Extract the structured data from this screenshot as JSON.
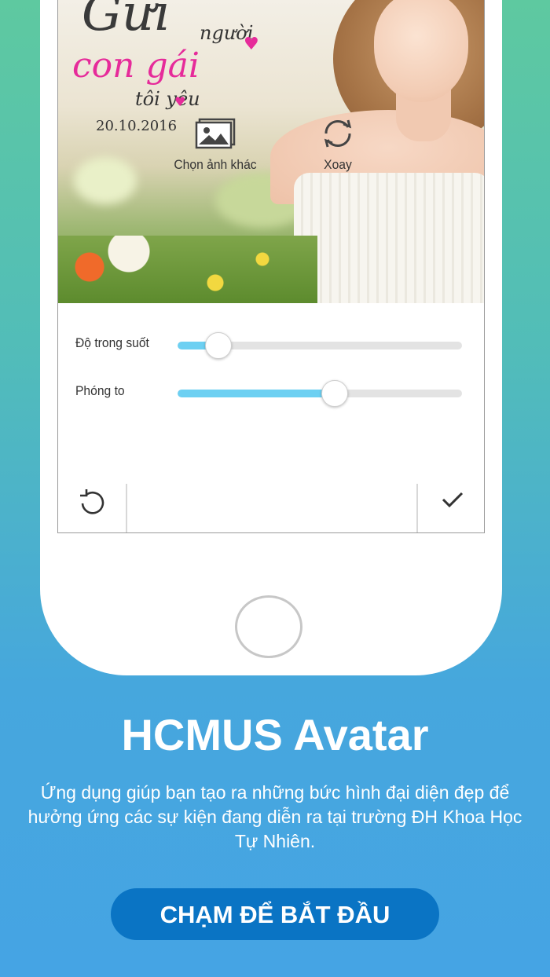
{
  "photo": {
    "title_line1": "Gửi",
    "title_line2": "người",
    "title_line3": "con gái",
    "title_line4": "tôi yêu",
    "date": "20.10.2016"
  },
  "editor": {
    "opacity": {
      "label": "Độ trong suốt",
      "value": 0.14
    },
    "zoom": {
      "label": "Phóng to",
      "value": 0.55
    },
    "choose_image_label": "Chọn ảnh khác",
    "rotate_label": "Xoay"
  },
  "icons": {
    "image": "image-icon",
    "rotate": "rotate-icon",
    "undo": "undo-icon",
    "confirm": "check-icon"
  },
  "app": {
    "title": "HCMUS Avatar",
    "description": "Ứng dụng giúp bạn tạo ra những bức hình đại diện đẹp để hưởng ứng các sự kiện đang diễn ra tại trường ĐH Khoa Học Tự Nhiên.",
    "cta_label": "CHẠM ĐỂ BẮT ĐẦU"
  },
  "colors": {
    "accent": "#6dd0f2",
    "cta": "#0a74c4",
    "title_pink": "#e62b9a"
  }
}
